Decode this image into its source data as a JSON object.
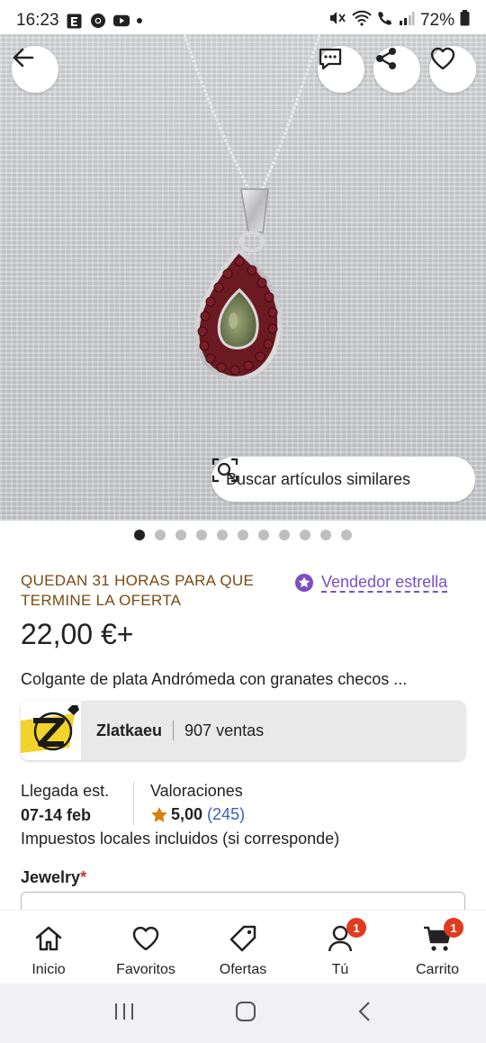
{
  "status_bar": {
    "time": "16:23",
    "battery": "72%"
  },
  "hero": {
    "similar_button_label": "Buscar artículos similares",
    "dot_count": 11,
    "active_dot": 0
  },
  "listing": {
    "offer_text": "QUEDAN 31 HORAS PARA QUE TERMINE LA OFERTA",
    "star_seller_label": "Vendedor estrella",
    "price": "22,00 €+",
    "title": "Colgante de plata Andrómeda con granates checos ...",
    "shop": {
      "name": "Zlatkaeu",
      "sales": "907 ventas"
    },
    "arrival": {
      "label": "Llegada est.",
      "value": "07-14 feb"
    },
    "ratings": {
      "label": "Valoraciones",
      "score": "5,00",
      "count": "(245)"
    },
    "taxes": "Impuestos locales incluidos (si corresponde)",
    "variation_label": "Jewelry",
    "required_mark": "*"
  },
  "tabs": [
    {
      "label": "Inicio",
      "icon": "home-icon"
    },
    {
      "label": "Favoritos",
      "icon": "heart-icon"
    },
    {
      "label": "Ofertas",
      "icon": "tag-icon"
    },
    {
      "label": "Tú",
      "icon": "user-icon",
      "badge": "1"
    },
    {
      "label": "Carrito",
      "icon": "cart-icon",
      "badge": "1"
    }
  ],
  "colors": {
    "offer": "#7a4a12",
    "star_seller": "#7b4fc3",
    "ratings_link": "#3a5ec4",
    "badge": "#e03a1f"
  }
}
